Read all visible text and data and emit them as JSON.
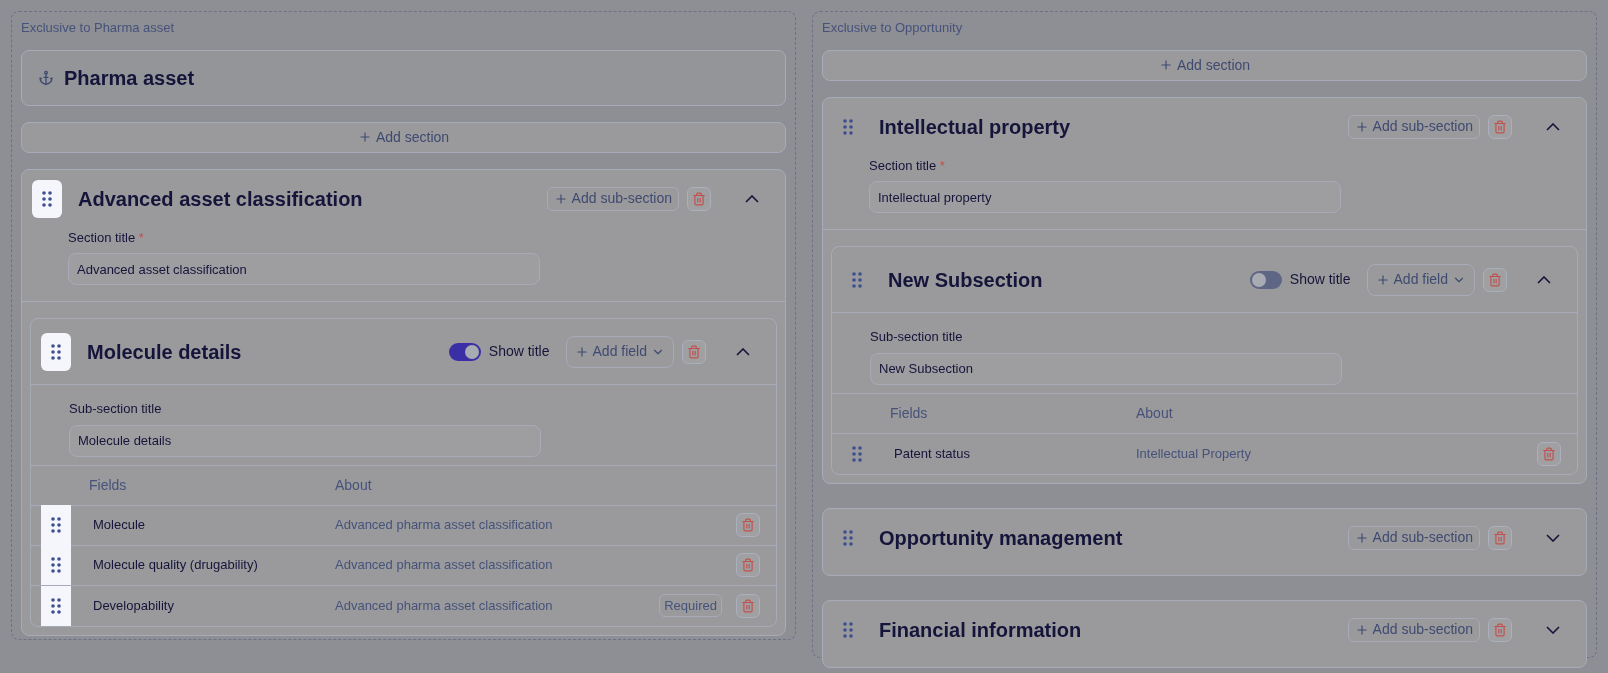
{
  "columns": [
    {
      "label": "Exclusive to Pharma asset",
      "header": {
        "title": "Pharma asset"
      },
      "add_section": "Add section",
      "sections": [
        {
          "title": "Advanced asset classification",
          "highlighted": true,
          "expanded": true,
          "add_sub": "Add sub-section",
          "field_label": "Section title",
          "required_mark": "*",
          "value": "Advanced asset classification",
          "subsections": [
            {
              "title": "Molecule details",
              "highlighted": true,
              "show_title": {
                "on": true,
                "label": "Show title"
              },
              "add_field": "Add field",
              "expanded": true,
              "field_label": "Sub-section title",
              "value": "Molecule details",
              "headers": [
                "Fields",
                "About"
              ],
              "rows": [
                {
                  "name": "Molecule",
                  "about": "Advanced pharma asset classification",
                  "highlighted": true
                },
                {
                  "name": "Molecule quality (drugability)",
                  "about": "Advanced pharma asset classification",
                  "highlighted": true
                },
                {
                  "name": "Developability",
                  "about": "Advanced pharma asset classification",
                  "highlighted": true,
                  "badge": "Required"
                }
              ]
            }
          ]
        }
      ]
    },
    {
      "label": "Exclusive to Opportunity",
      "add_section": "Add section",
      "sections": [
        {
          "title": "Intellectual property",
          "highlighted": false,
          "expanded": true,
          "add_sub": "Add sub-section",
          "field_label": "Section title",
          "required_mark": "*",
          "value": "Intellectual property",
          "subsections": [
            {
              "title": "New Subsection",
              "highlighted": false,
              "show_title": {
                "on": false,
                "label": "Show title"
              },
              "add_field": "Add field",
              "expanded": true,
              "field_label": "Sub-section title",
              "value": "New Subsection",
              "headers": [
                "Fields",
                "About"
              ],
              "rows": [
                {
                  "name": "Patent status",
                  "about": "Intellectual Property",
                  "highlighted": false
                }
              ]
            }
          ]
        },
        {
          "title": "Opportunity management",
          "highlighted": false,
          "expanded": false,
          "add_sub": "Add sub-section"
        },
        {
          "title": "Financial information",
          "highlighted": false,
          "expanded": false,
          "add_sub": "Add sub-section"
        }
      ]
    }
  ]
}
